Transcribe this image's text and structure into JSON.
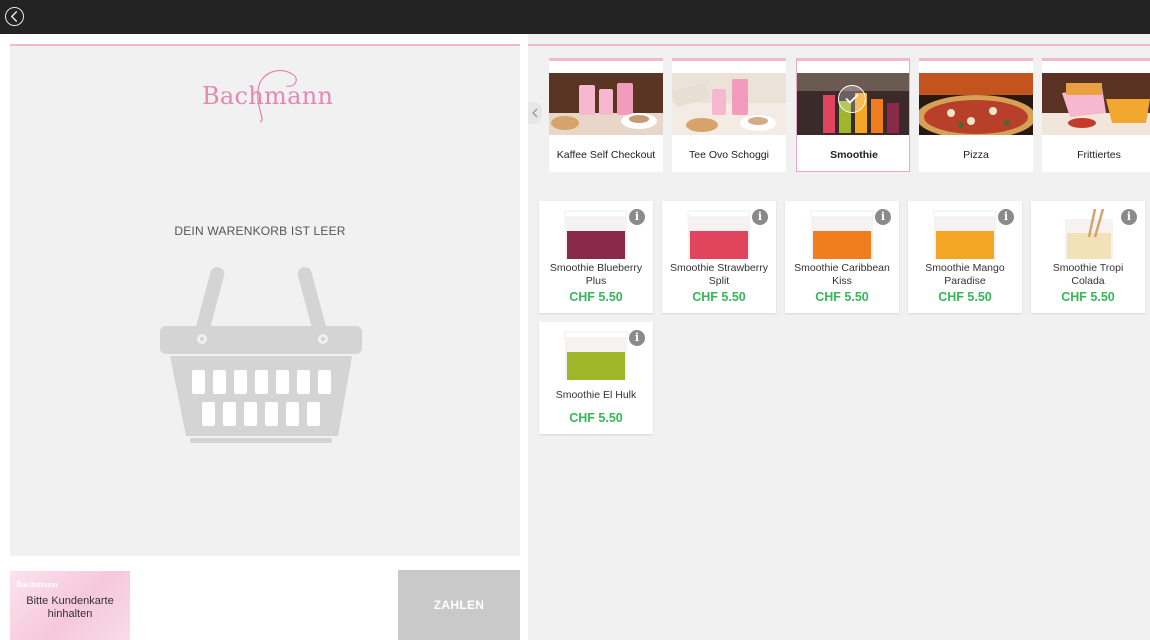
{
  "app": {
    "brand": "Bachmann"
  },
  "cart": {
    "empty_text": "DEIN WARENKORB IST LEER",
    "customer_card_brand": "Bachmann",
    "customer_card_text": "Bitte Kundenkarte hinhalten",
    "pay_label": "ZAHLEN"
  },
  "categories": [
    {
      "label": "Kaffee Self Checkout",
      "selected": false
    },
    {
      "label": "Tee Ovo Schoggi",
      "selected": false
    },
    {
      "label": "Smoothie",
      "selected": true
    },
    {
      "label": "Pizza",
      "selected": false
    },
    {
      "label": "Frittiertes",
      "selected": false
    }
  ],
  "products": [
    {
      "name": "Smoothie Blueberry Plus",
      "price": "CHF 5.50",
      "color": "#8a2a4a"
    },
    {
      "name": "Smoothie Strawberry Split",
      "price": "CHF 5.50",
      "color": "#e2445e"
    },
    {
      "name": "Smoothie Caribbean Kiss",
      "price": "CHF 5.50",
      "color": "#f07e1e"
    },
    {
      "name": "Smoothie Mango Paradise",
      "price": "CHF 5.50",
      "color": "#f3a623"
    },
    {
      "name": "Smoothie Tropi Colada",
      "price": "CHF 5.50",
      "color": "#f1e2b8"
    },
    {
      "name": "Smoothie El Hulk",
      "price": "CHF 5.50",
      "color": "#9fb52a"
    }
  ],
  "colors": {
    "accent_pink": "#f2b8d0",
    "price_green": "#35b85a",
    "pay_button": "#c9c9c9",
    "topbar": "#232323"
  }
}
